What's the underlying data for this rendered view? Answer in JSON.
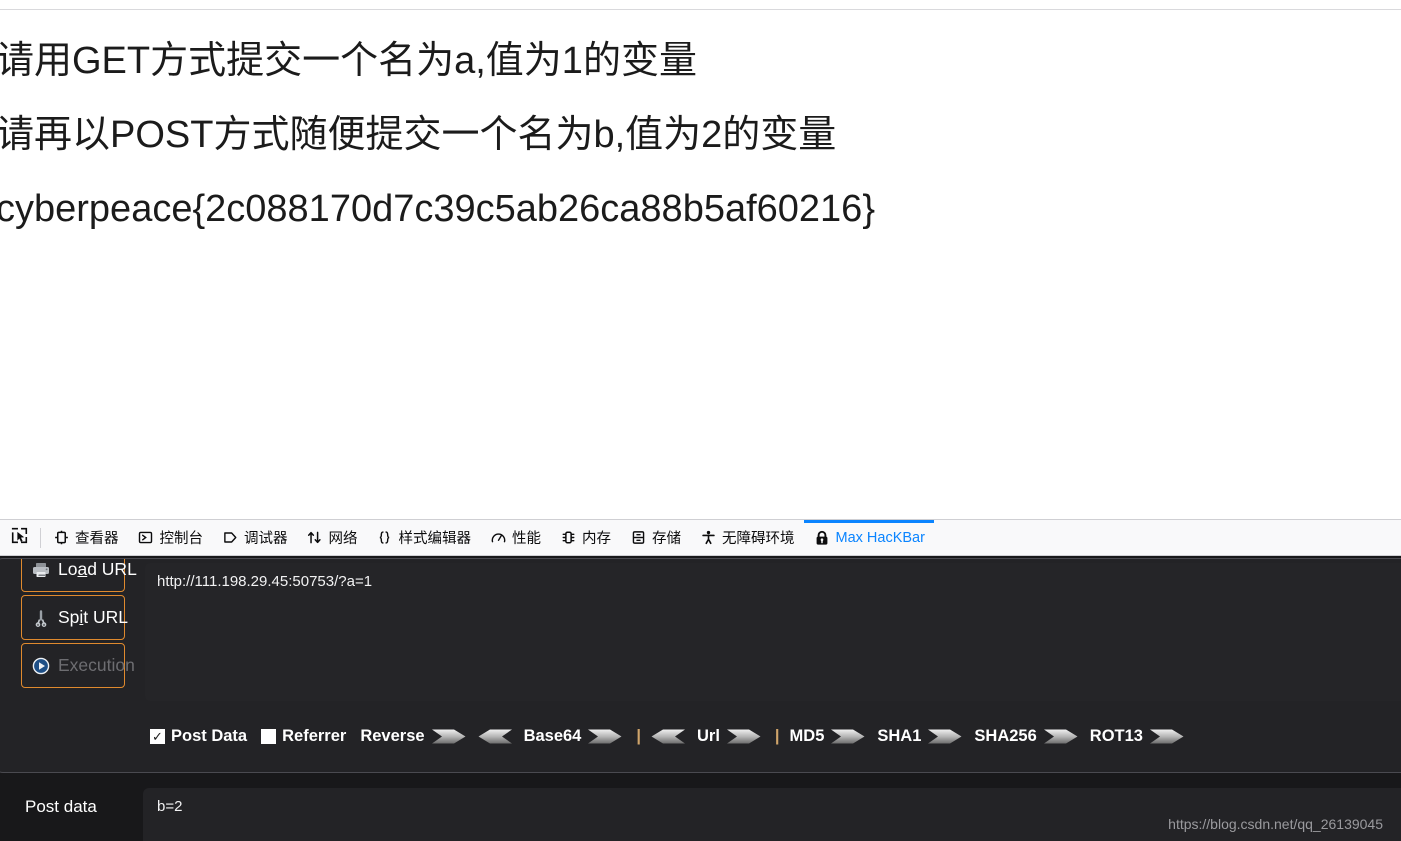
{
  "page": {
    "lines": [
      "请用GET方式提交一个名为a,值为1的变量",
      "请再以POST方式随便提交一个名为b,值为2的变量",
      "cyberpeace{2c088170d7c39c5ab26ca88b5af60216}"
    ]
  },
  "devtools": {
    "picker_icon": "element-picker-icon",
    "active_tab": "Max HacKBar",
    "accent_color": "#0a84ff",
    "tabs": [
      {
        "label": "查看器",
        "icon": "inspector-icon",
        "active": false
      },
      {
        "label": "控制台",
        "icon": "console-icon",
        "active": false
      },
      {
        "label": "调试器",
        "icon": "debugger-icon",
        "active": false
      },
      {
        "label": "网络",
        "icon": "network-arrows-icon",
        "active": false
      },
      {
        "label": "样式编辑器",
        "icon": "style-editor-braces-icon",
        "active": false
      },
      {
        "label": "性能",
        "icon": "performance-gauge-icon",
        "active": false
      },
      {
        "label": "内存",
        "icon": "memory-chip-icon",
        "active": false
      },
      {
        "label": "存储",
        "icon": "storage-drawers-icon",
        "active": false
      },
      {
        "label": "无障碍环境",
        "icon": "accessibility-person-icon",
        "active": false
      },
      {
        "label": "Max HacKBar",
        "icon": "lock-icon",
        "active": true
      }
    ]
  },
  "hackbar": {
    "border_color": "#e08a2e",
    "buttons": [
      {
        "label_pre": "Lo",
        "label_accel": "a",
        "label_post": "d URL",
        "name": "load-url-button",
        "icon": "printer-icon",
        "disabled": false
      },
      {
        "label_pre": "Sp",
        "label_accel": "i",
        "label_post": "t URL",
        "name": "spit-url-button",
        "icon": "scissors-icon",
        "disabled": false
      },
      {
        "label_pre": "Exec",
        "label_accel": "u",
        "label_post": "tion",
        "name": "execution-button",
        "icon": "play-icon",
        "disabled": true
      }
    ],
    "url": {
      "value": "http://111.198.29.45:50753/?a=1",
      "placeholder": "URL"
    },
    "checkboxes": [
      {
        "label": "Post Data",
        "checked": true,
        "name": "post-data-checkbox"
      },
      {
        "label": "Referrer",
        "checked": false,
        "name": "referrer-checkbox"
      }
    ],
    "ops": [
      {
        "label": "Reverse",
        "arrows": [
          "right",
          "left"
        ],
        "name": "reverse-op"
      },
      {
        "label": "Base64",
        "arrows": [
          "right"
        ],
        "name": "base64-op",
        "divider_before": false
      },
      {
        "label": "Url",
        "arrows": [
          "left",
          "right"
        ],
        "name": "url-op",
        "divider_before": true
      },
      {
        "label": "MD5",
        "arrows": [
          "right"
        ],
        "name": "md5-op",
        "divider_before": true
      },
      {
        "label": "SHA1",
        "arrows": [
          "right"
        ],
        "name": "sha1-op",
        "divider_before": false
      },
      {
        "label": "SHA256",
        "arrows": [
          "right"
        ],
        "name": "sha256-op",
        "divider_before": false
      },
      {
        "label": "ROT13",
        "arrows": [
          "right"
        ],
        "name": "rot13-op",
        "divider_before": false
      }
    ],
    "divider_glyph": "|",
    "post_data": {
      "label": "Post data",
      "value": "b=2",
      "placeholder": "Post data"
    }
  },
  "watermark": {
    "text": "https://blog.csdn.net/qq_26139045"
  }
}
